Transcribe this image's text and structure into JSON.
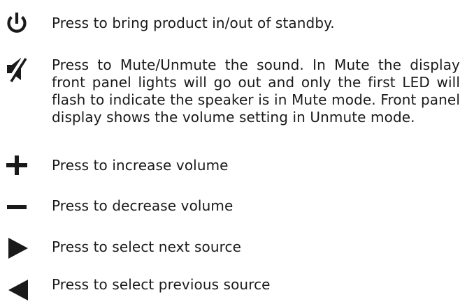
{
  "controls": [
    {
      "icon": "power-icon",
      "description": "Press to bring product in/out of standby."
    },
    {
      "icon": "mute-speaker-icon",
      "description": "Press to Mute/Unmute the sound. In Mute the display front panel lights will go out and only the first LED will flash to indicate the speaker is in Mute mode. Front panel display shows the volume setting in Unmute mode."
    },
    {
      "icon": "plus-icon",
      "description": "Press to increase volume"
    },
    {
      "icon": "minus-icon",
      "description": "Press to decrease volume"
    },
    {
      "icon": "play-right-icon",
      "description": "Press to select next source"
    },
    {
      "icon": "play-left-icon",
      "description": "Press to select previous source"
    }
  ],
  "colors": {
    "icon": "#1a1a1a",
    "text": "#1a1a1a",
    "background": "#ffffff"
  }
}
